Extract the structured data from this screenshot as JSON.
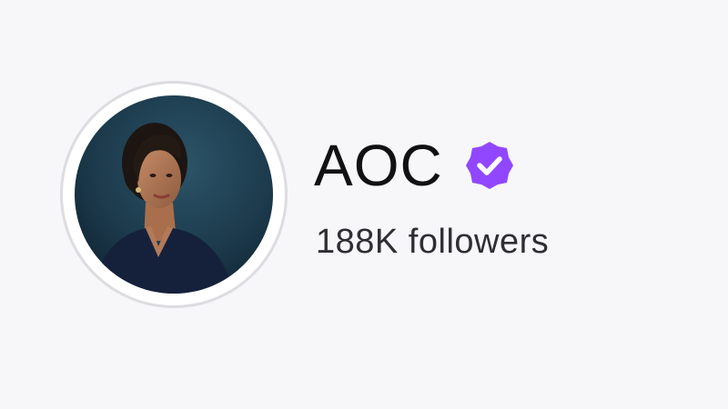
{
  "profile": {
    "name": "AOC",
    "followers": "188K followers",
    "verified": true
  },
  "icons": {
    "badge": "verified-check-icon",
    "avatar": "profile-photo"
  },
  "colors": {
    "background": "#f7f7f9",
    "name_text": "#111114",
    "followers_text": "#2e2e33",
    "badge": "#9147ff",
    "avatar_ring": "#dcdce1"
  }
}
